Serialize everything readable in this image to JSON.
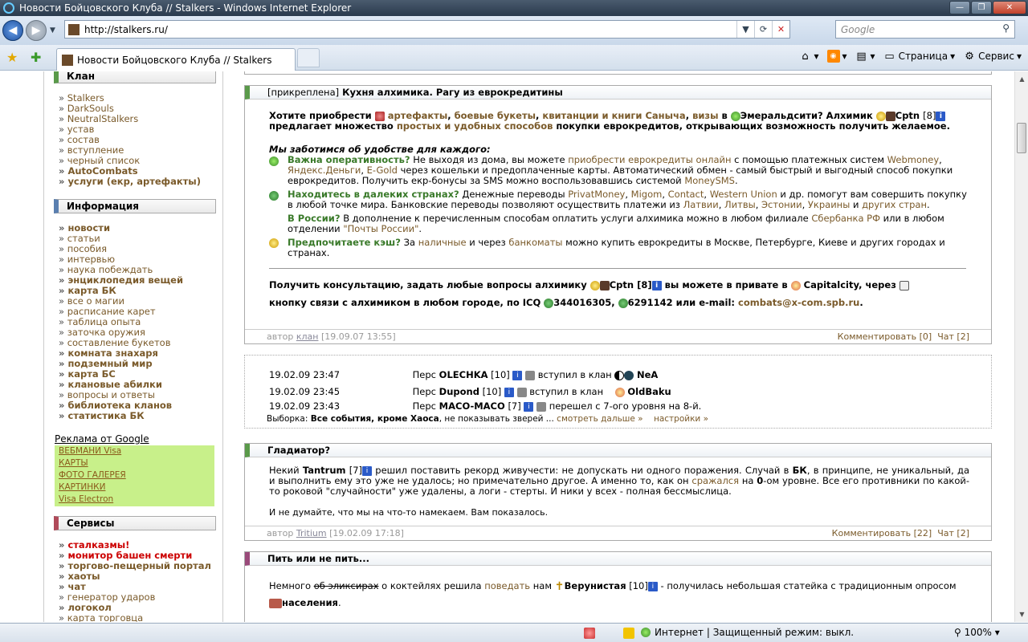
{
  "window": {
    "title": "Новости Бойцовского Клуба // Stalkers - Windows Internet Explorer"
  },
  "address": {
    "url": "http://stalkers.ru/",
    "search_placeholder": "Google"
  },
  "tab": {
    "title": "Новости Бойцовского Клуба // Stalkers"
  },
  "tools": {
    "page": "Страница",
    "service": "Сервис"
  },
  "sidebar": {
    "clan_title": "Клан",
    "clan_items": [
      "Stalkers",
      "DarkSouls",
      "NeutralStalkers",
      "устав",
      "состав",
      "вступление",
      "черный список",
      "AutoCombats",
      "услуги (екр, артефакты)"
    ],
    "info_title": "Информация",
    "info_items": [
      "новости",
      "статьи",
      "пособия",
      "интервью",
      "наука побеждать",
      "энциклопедия вещей",
      "карта БК",
      "все о магии",
      "расписание карет",
      "таблица опыта",
      "заточка оружия",
      "составление букетов",
      "комната знахаря",
      "подземный мир",
      "карта БС",
      "клановые абилки",
      "вопросы и ответы",
      "библиотека кланов",
      "статистика БК"
    ],
    "ads_title": "Реклама от Google",
    "ads": [
      "ВЕБМАНИ Visa",
      "КАРТЫ",
      "ФОТО ГАЛЕРЕЯ",
      "КАРТИНКИ",
      "Visa Electron"
    ],
    "services_title": "Сервисы",
    "services_items": [
      "сталказмы!",
      "монитор башен смерти",
      "торгово-пещерный портал",
      "хаоты",
      "чат",
      "генератор ударов",
      "логокол",
      "карта торговца"
    ]
  },
  "post1": {
    "pinned": "[прикреплена]",
    "title": "Кухня алхимика. Рагу из еврокредитины",
    "intro_a": "Хотите приобрести",
    "artifacts": "артефакты",
    "bouquets": "боевые букеты",
    "receipts": "квитанции и книги Саныча",
    "visas": "визы",
    "in": "в",
    "emerald": "Эмеральдсити? Алхимик",
    "cptn": "Cptn",
    "cptn_lvl": "[8]",
    "intro_b": "предлагает множество",
    "ways": "простых и удобных способов",
    "intro_c": "покупки еврокредитов, открывающих возможность получить желаемое.",
    "care": "Мы заботимся об удобстве для каждого:",
    "op_head": "Важна оперативность?",
    "op_a": "Не выходя из дома, вы можете",
    "op_link": "приобрести еврокредиты онлайн",
    "op_b": "с помощью платежных систем",
    "webmoney": "Webmoney",
    "yandex": "Яндекс.Деньги",
    "egold": "E-Gold",
    "op_c": "через кошельки и предоплаченные карты. Автоматический обмен - самый быстрый и выгодный способ покупки еврокредитов. Получить екр-бонусы за SMS можно воспользовавшись системой",
    "moneysms": "MoneySMS",
    "far_head": "Находитесь в далеких странах?",
    "far_a": "Денежные переводы",
    "privat": "PrivatMoney",
    "migom": "Migom",
    "contact": "Contact",
    "wu": "Western Union",
    "far_b": "и др. помогут вам совершить покупку в любой точке мира. Банковские переводы позволяют осуществить платежи из",
    "latvia": "Латвии",
    "lithuania": "Литвы",
    "estonia": "Эстонии",
    "ukraine": "Украины",
    "and": "и",
    "other": "других стран",
    "ru_head": "В России?",
    "ru_a": "В дополнение к перечисленным способам оплатить услуги алхимика можно в любом филиале",
    "sber": "Сбербанка РФ",
    "ru_b": "или в любом отделении",
    "post": "\"Почты России\"",
    "cash_head": "Предпочитаете кэш?",
    "cash_a": "За",
    "cash_link": "наличные",
    "cash_b": "и через",
    "atm": "банкоматы",
    "cash_c": "можно купить еврокредиты в Москве, Петербурге, Киеве и других городах и странах.",
    "consult_a": "Получить консультацию, задать любые вопросы алхимику",
    "consult_b": "вы можете в привате в",
    "capital": "Capitalcity, через",
    "consult_c": "кнопку связи с алхимиком в любом городе, по ICQ",
    "icq1": "344016305,",
    "icq2": "6291142 или e-mail:",
    "email": "combats@x-com.spb.ru",
    "author_label": "автор",
    "author": "клан",
    "date": "[19.09.07 13:55]",
    "comments": "Комментировать [0]",
    "chat": "Чат [2]"
  },
  "events": {
    "rows": [
      {
        "time": "19.02.09 23:47",
        "pers": "Перс",
        "name": "OLECHKA",
        "lvl": "[10]",
        "action": "вступил в клан",
        "clan": "NeA"
      },
      {
        "time": "19.02.09 23:45",
        "pers": "Перс",
        "name": "Dupond",
        "lvl": "[10]",
        "action": "вступил в клан",
        "clan": "OldBaku"
      },
      {
        "time": "19.02.09 23:43",
        "pers": "Перс",
        "name": "MACO-MACO",
        "lvl": "[7]",
        "action": "перешел с 7-ого уровня на 8-й.",
        "clan": ""
      }
    ],
    "filter_label": "Выборка:",
    "filter_value": "Все события, кроме Хаоса",
    "filter_rest": ", не показывать зверей ...",
    "more": "смотреть дальше »",
    "settings": "настройки »"
  },
  "post2": {
    "title": "Гладиатор?",
    "a": "Некий",
    "name": "Tantrum",
    "lvl": "[7]",
    "b": "решил поставить рекорд живучести: не допускать ни одного поражения. Случай в",
    "bk": "БК",
    "c": ", в принципе, не уникальный, да и выполнить ему это уже не удалось; но примечательно другое. А именно то, как он",
    "fought": "сражался",
    "d": "на",
    "zero": "0",
    "e": "-ом уровне. Все его противники по какой-то роковой \"случайности\" уже удалены, а логи - стерты. И ники у всех - полная бессмыслица.",
    "f": "И не думайте, что мы на что-то намекаем. Вам показалось.",
    "author_label": "автор",
    "author": "Tritium",
    "date": "[19.02.09 17:18]",
    "comments": "Комментировать [22]",
    "chat": "Чат [2]"
  },
  "post3": {
    "title": "Пить или не пить...",
    "a": "Немного",
    "strike": "об эликсирах",
    "b": "о коктейлях решила",
    "tell": "поведать",
    "c": "нам",
    "name": "Верунистая",
    "lvl": "[10]",
    "d": "- получилась небольшая статейка с традиционным опросом",
    "e": "населения"
  },
  "status": {
    "zone": "Интернет | Защищенный режим: выкл.",
    "zoom": "100%"
  }
}
